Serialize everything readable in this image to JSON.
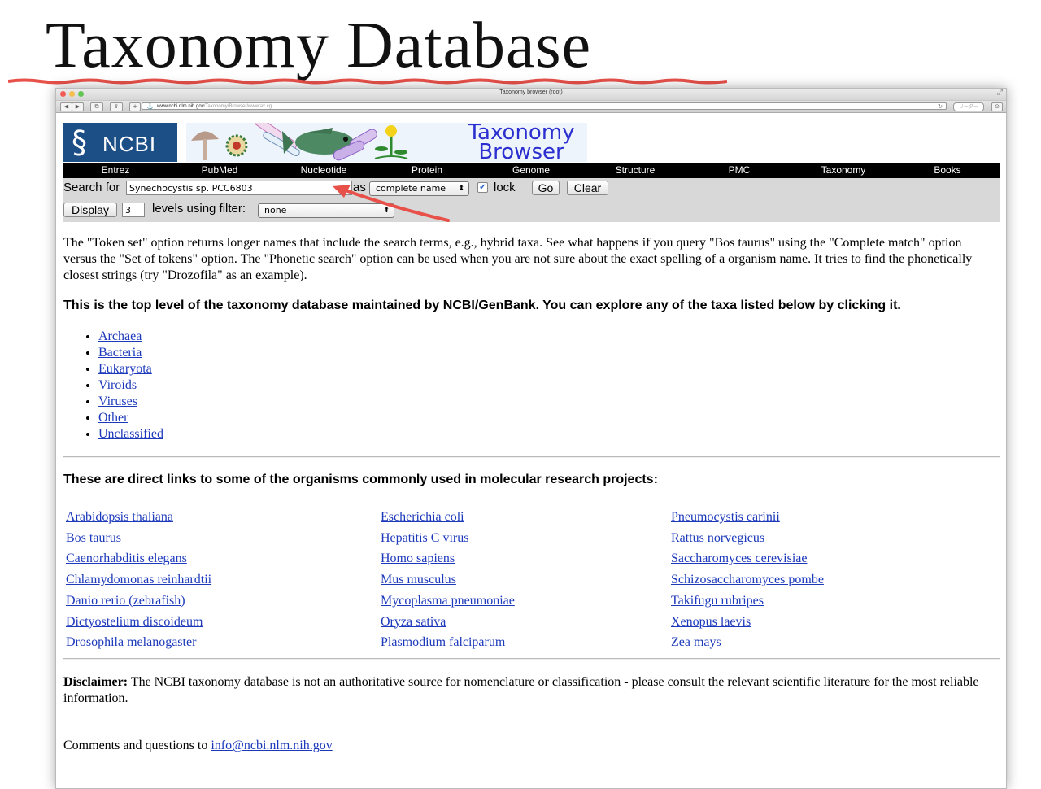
{
  "slide": {
    "title": "Taxonomy Database"
  },
  "browser": {
    "window_title": "Taxonomy browser (root)",
    "url_host": "www.ncbi.nlm.nih.gov",
    "url_path": "/Taxonomy/Browser/wwwtax.cgi",
    "reader_label": "リーダー"
  },
  "header": {
    "ncbi_logo_text": "NCBI",
    "banner_title_line1": "Taxonomy",
    "banner_title_line2": "Browser"
  },
  "nav": {
    "items": [
      "Entrez",
      "PubMed",
      "Nucleotide",
      "Protein",
      "Genome",
      "Structure",
      "PMC",
      "Taxonomy",
      "Books"
    ]
  },
  "search": {
    "search_for_label": "Search for",
    "query_value": "Synechocystis sp. PCC6803",
    "as_label": "as",
    "mode_selected": "complete name",
    "lock_label": "lock",
    "lock_checked": true,
    "go_label": "Go",
    "clear_label": "Clear",
    "display_label": "Display",
    "levels_value": "3",
    "levels_label": "levels using filter:",
    "filter_selected": "none"
  },
  "annotation": {
    "arrow_color": "#e8514a",
    "underline_color": "#e8514a"
  },
  "intro_paragraph": "The \"Token set\" option returns longer names that include the search terms, e.g., hybrid taxa. See what happens if you query \"Bos taurus\" using the \"Complete match\" option versus the \"Set of tokens\" option. The \"Phonetic search\" option can be used when you are not sure about the exact spelling of a organism name. It tries to find the phonetically closest strings (try \"Drozofila\" as an example).",
  "top_level_heading": "This is the top level of the taxonomy database maintained by NCBI/GenBank. You can explore any of the taxa listed below by clicking it.",
  "top_level_taxa": [
    "Archaea",
    "Bacteria",
    "Eukaryota",
    "Viroids",
    "Viruses",
    "Other",
    "Unclassified"
  ],
  "organisms_heading": "These are direct links to some of the organisms commonly used in molecular research projects:",
  "organisms": {
    "col1": [
      "Arabidopsis thaliana",
      "Bos taurus",
      "Caenorhabditis elegans",
      "Chlamydomonas reinhardtii",
      "Danio rerio (zebrafish)",
      "Dictyostelium discoideum",
      "Drosophila melanogaster"
    ],
    "col2": [
      "Escherichia coli",
      "Hepatitis C virus",
      "Homo sapiens",
      "Mus musculus",
      "Mycoplasma pneumoniae",
      "Oryza sativa",
      "Plasmodium falciparum"
    ],
    "col3": [
      "Pneumocystis carinii",
      "Rattus norvegicus",
      "Saccharomyces cerevisiae",
      "Schizosaccharomyces pombe",
      "Takifugu rubripes",
      "Xenopus laevis",
      "Zea mays"
    ]
  },
  "disclaimer": {
    "label": "Disclaimer:",
    "text": " The NCBI taxonomy database is not an authoritative source for nomenclature or classification - please consult the relevant scientific literature for the most reliable information."
  },
  "comments": {
    "text": "Comments and questions to ",
    "email": "info@ncbi.nlm.nih.gov"
  }
}
